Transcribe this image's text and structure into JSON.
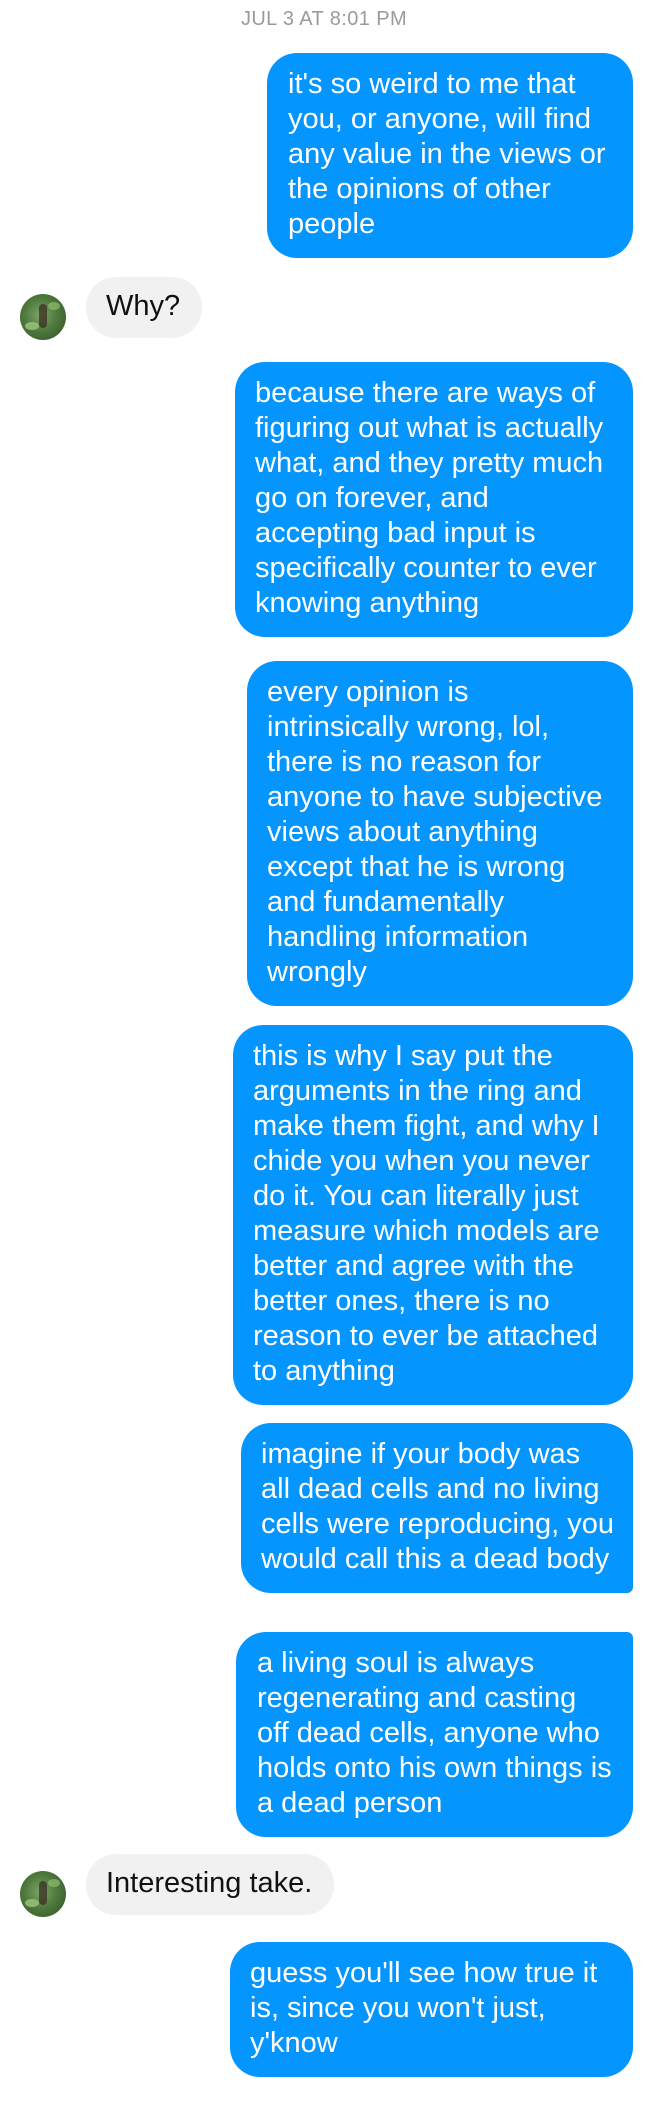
{
  "conversation": {
    "timestamp": "JUL 3 AT 8:01 PM",
    "messages": [
      {
        "sender": "me",
        "text": "it's so weird to me that you, or anyone, will find any value in the views or the opinions of other people"
      },
      {
        "sender": "other",
        "text": "Why?"
      },
      {
        "sender": "me",
        "text": "because there are ways of figuring out what is actually what, and they pretty much go on forever, and accepting bad input is specifically counter to ever knowing anything"
      },
      {
        "sender": "me",
        "text": "every opinion is intrinsically wrong, lol, there is no reason for anyone to have subjective views about anything except that he is wrong and fundamentally handling information wrongly"
      },
      {
        "sender": "me",
        "text": "this is why I say put the arguments in the ring and make them fight, and why I chide you when you never do it. You can literally just measure which models are better and agree with the better ones, there is no reason to ever be attached to anything"
      },
      {
        "sender": "me",
        "text": "imagine if your body was all dead cells and no living cells were reproducing, you would call this a dead body"
      },
      {
        "sender": "me",
        "text": "a living soul is always regenerating and casting off dead cells, anyone who holds onto his own things is a dead person"
      },
      {
        "sender": "other",
        "text": "Interesting take."
      },
      {
        "sender": "me",
        "text": "guess you'll see how true it is, since you won't just, y'know"
      }
    ]
  },
  "colors": {
    "sent_bubble": "#0595ff",
    "received_bubble": "#f1f1f1",
    "timestamp_text": "#9a9a9a"
  },
  "icons": {
    "avatar": "contact-avatar-photo"
  }
}
